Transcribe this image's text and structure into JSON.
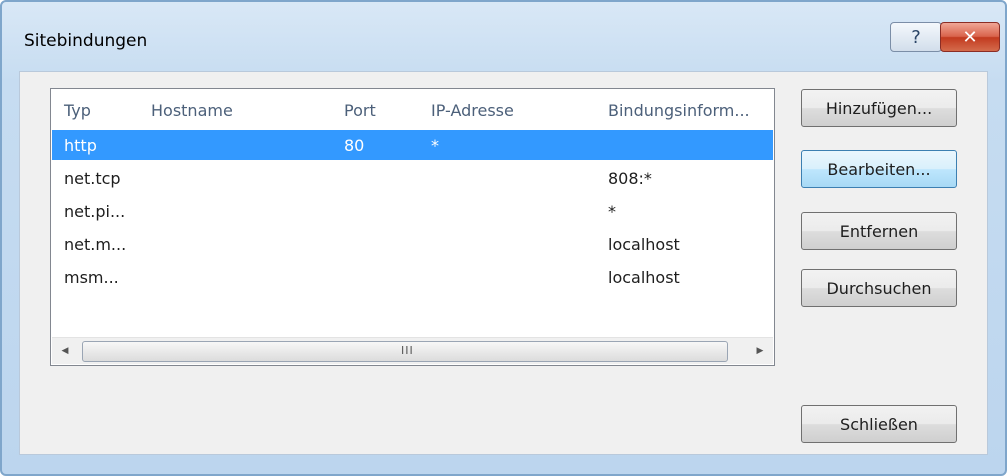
{
  "window": {
    "title": "Sitebindungen",
    "help_glyph": "?",
    "close_glyph": "✕"
  },
  "listview": {
    "columns": [
      "Typ",
      "Hostname",
      "Port",
      "IP-Adresse",
      "Bindungsinform..."
    ],
    "rows": [
      {
        "typ": "http",
        "hostname": "",
        "port": "80",
        "ip": "*",
        "binding": "",
        "selected": true
      },
      {
        "typ": "net.tcp",
        "hostname": "",
        "port": "",
        "ip": "",
        "binding": "808:*",
        "selected": false
      },
      {
        "typ": "net.pi...",
        "hostname": "",
        "port": "",
        "ip": "",
        "binding": "*",
        "selected": false
      },
      {
        "typ": "net.m...",
        "hostname": "",
        "port": "",
        "ip": "",
        "binding": "localhost",
        "selected": false
      },
      {
        "typ": "msm...",
        "hostname": "",
        "port": "",
        "ip": "",
        "binding": "localhost",
        "selected": false
      }
    ],
    "scrollbar": {
      "left_arrow": "◀",
      "right_arrow": "▶",
      "grip": "III"
    }
  },
  "buttons": {
    "add": "Hinzufügen...",
    "edit": "Bearbeiten...",
    "remove": "Entfernen",
    "browse": "Durchsuchen",
    "close": "Schließen"
  },
  "colors": {
    "selection": "#3399ff",
    "title_bar": "#c6dcf1",
    "close_button": "#c23a1f"
  }
}
